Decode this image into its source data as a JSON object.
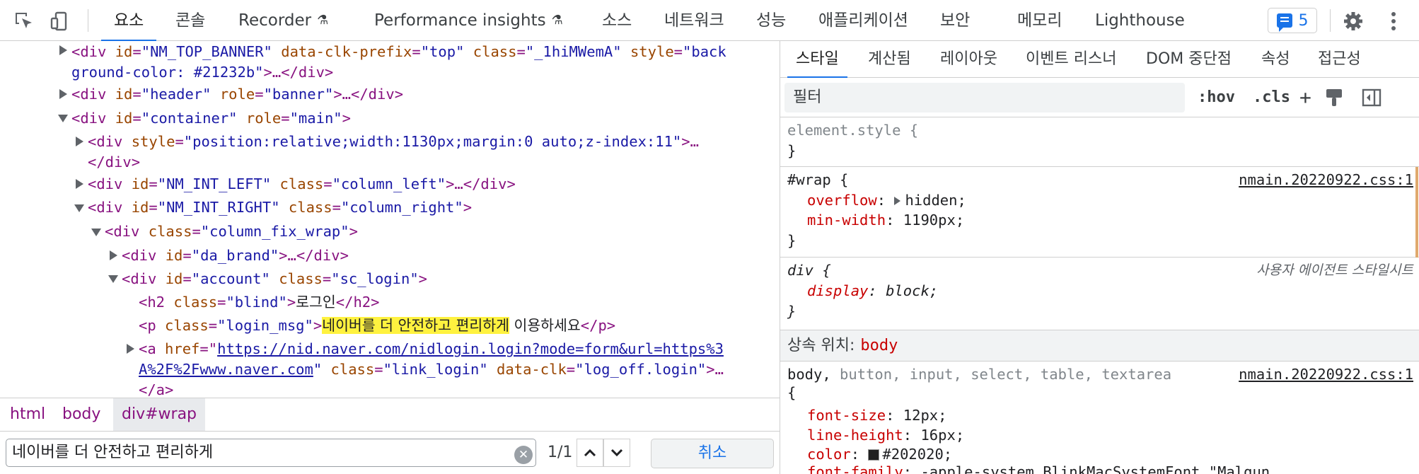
{
  "toolbar": {
    "tabs": [
      {
        "label": "요소",
        "active": true
      },
      {
        "label": "콘솔"
      },
      {
        "label": "Recorder",
        "experimental": true
      },
      {
        "label": "Performance insights",
        "experimental": true
      },
      {
        "label": "소스"
      },
      {
        "label": "네트워크"
      },
      {
        "label": "성능"
      },
      {
        "label": "애플리케이션"
      },
      {
        "label": "보안"
      },
      {
        "label": "메모리"
      },
      {
        "label": "Lighthouse"
      }
    ],
    "issues_count": "5",
    "icons": [
      "inspect-element-icon",
      "device-toolbar-icon",
      "flask-icon",
      "message-icon",
      "gear-icon",
      "kebab-menu-icon"
    ]
  },
  "dom": {
    "l1a": {
      "tag": "<div ",
      "a1": "id",
      "v1": "\"NM_TOP_BANNER\"",
      "a2": "data-clk-prefix",
      "v2": "\"top\"",
      "a3": "class",
      "v3": "\"_1hiMWemA\"",
      "a4": "style",
      "v4a": "\"back"
    },
    "l1b": {
      "v4b": "ground-color: #21232b\"",
      "close": ">…</div>"
    },
    "l2": {
      "tag": "<div ",
      "a1": "id",
      "v1": "\"header\"",
      "a2": "role",
      "v2": "\"banner\"",
      "close": ">…</div>"
    },
    "l3": {
      "tag": "<div ",
      "a1": "id",
      "v1": "\"container\"",
      "a2": "role",
      "v2": "\"main\"",
      "close": ">"
    },
    "l4": {
      "tag": "<div ",
      "a1": "style",
      "v1": "\"position:relative;width:1130px;margin:0 auto;z-index:11\"",
      "close": ">…"
    },
    "l4b": "</div>",
    "l5": {
      "tag": "<div ",
      "a1": "id",
      "v1": "\"NM_INT_LEFT\"",
      "a2": "class",
      "v2": "\"column_left\"",
      "close": ">…</div>"
    },
    "l6": {
      "tag": "<div ",
      "a1": "id",
      "v1": "\"NM_INT_RIGHT\"",
      "a2": "class",
      "v2": "\"column_right\"",
      "close": ">"
    },
    "l7": {
      "tag": "<div ",
      "a1": "class",
      "v1": "\"column_fix_wrap\"",
      "close": ">"
    },
    "l8": {
      "tag": "<div ",
      "a1": "id",
      "v1": "\"da_brand\"",
      "close": ">…</div>"
    },
    "l9": {
      "tag": "<div ",
      "a1": "id",
      "v1": "\"account\"",
      "a2": "class",
      "v2": "\"sc_login\"",
      "close": ">"
    },
    "l10": {
      "tag": "<h2 ",
      "a1": "class",
      "v1": "\"blind\"",
      "text": "로그인",
      "close": "</h2>"
    },
    "l11": {
      "tag": "<p ",
      "a1": "class",
      "v1": "\"login_msg\"",
      "highlight": "네이버를 더 안전하고 편리하게",
      "text": " 이용하세요",
      "close": "</p>"
    },
    "l12": {
      "tag": "<a ",
      "a1": "href",
      "v1a": "https://nid.naver.com/nidlogin.login?mode=form&url=https%3"
    },
    "l12b": {
      "v1b": "A%2F%2Fwww.naver.com",
      "a2": "class",
      "v2": "\"link_login\"",
      "a3": "data-clk",
      "v3": "\"log_off.login\"",
      "close": ">…"
    },
    "l12c": "</a>"
  },
  "breadcrumbs": [
    "html",
    "body",
    "div#wrap"
  ],
  "search": {
    "value": "네이버를 더 안전하고 편리하게",
    "match": "1/1",
    "cancel": "취소"
  },
  "styles": {
    "tabs": [
      "스타일",
      "계산됨",
      "레이아웃",
      "이벤트 리스너",
      "DOM 중단점",
      "속성",
      "접근성"
    ],
    "filter_placeholder": "필터",
    "hov": ":hov",
    "cls": ".cls",
    "element_style": {
      "selector": "element.style {",
      "close": "}"
    },
    "wrap": {
      "selector": "#wrap {",
      "source": "nmain.20220922.css:1",
      "p1": "overflow",
      "v1": "hidden;",
      "p2": "min-width",
      "v2": "1190px;",
      "close": "}"
    },
    "div_ua": {
      "selector": "div {",
      "source": "사용자 에이전트 스타일시트",
      "p1": "display",
      "v1": "block;",
      "close": "}"
    },
    "inherited": {
      "label": "상속 위치:",
      "from": "body"
    },
    "body_rule": {
      "sel_main": "body,",
      "sel_rest": " button, input, select, table, textarea",
      "source": "nmain.20220922.css:1",
      "open": "{",
      "p1": "font-size",
      "v1": "12px;",
      "p2": "line-height",
      "v2": "16px;",
      "p3": "color",
      "v3": "#202020;",
      "p4": "font-family",
      "v4": "-apple-system,BlinkMacSystemFont,\"Malgun"
    }
  }
}
